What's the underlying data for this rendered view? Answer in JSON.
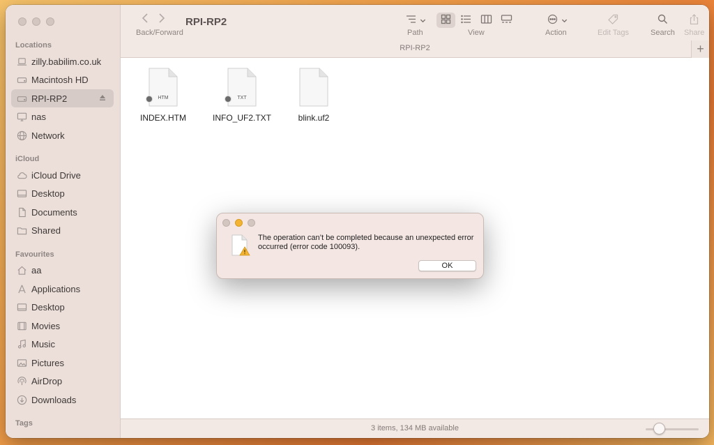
{
  "window": {
    "title": "RPI-RP2"
  },
  "sidebar": {
    "locations_title": "Locations",
    "locations": [
      {
        "label": "zilly.babilim.co.uk",
        "icon": "laptop-icon"
      },
      {
        "label": "Macintosh HD",
        "icon": "drive-icon"
      },
      {
        "label": "RPI-RP2",
        "icon": "drive-icon",
        "active": true
      },
      {
        "label": "nas",
        "icon": "display-icon"
      },
      {
        "label": "Network",
        "icon": "globe-icon"
      }
    ],
    "icloud_title": "iCloud",
    "icloud": [
      {
        "label": "iCloud Drive",
        "icon": "cloud-icon"
      },
      {
        "label": "Desktop",
        "icon": "desktop-icon"
      },
      {
        "label": "Documents",
        "icon": "document-icon"
      },
      {
        "label": "Shared",
        "icon": "shared-folder-icon"
      }
    ],
    "favourites_title": "Favourites",
    "favourites": [
      {
        "label": "aa",
        "icon": "home-icon"
      },
      {
        "label": "Applications",
        "icon": "applications-icon"
      },
      {
        "label": "Desktop",
        "icon": "desktop-icon"
      },
      {
        "label": "Movies",
        "icon": "film-icon"
      },
      {
        "label": "Music",
        "icon": "music-note-icon"
      },
      {
        "label": "Pictures",
        "icon": "photo-icon"
      },
      {
        "label": "AirDrop",
        "icon": "airdrop-icon"
      },
      {
        "label": "Downloads",
        "icon": "download-icon"
      }
    ],
    "tags_title": "Tags"
  },
  "toolbar": {
    "back_forward_label": "Back/Forward",
    "path_label": "Path",
    "view_label": "View",
    "action_label": "Action",
    "edit_tags_label": "Edit Tags",
    "search_label": "Search",
    "share_label": "Share",
    "path_bar": "RPI-RP2"
  },
  "files": [
    {
      "name": "INDEX.HTM",
      "ext": "HTM",
      "badge": true
    },
    {
      "name": "INFO_UF2.TXT",
      "ext": "TXT",
      "badge": true
    },
    {
      "name": "blink.uf2",
      "ext": "",
      "badge": false
    }
  ],
  "status": {
    "text": "3 items, 134 MB available",
    "icon_size_level": 0.25
  },
  "alert": {
    "message": "The operation can’t be completed because an unexpected error occurred (error code 100093).",
    "ok_label": "OK"
  },
  "colors": {
    "sidebar_bg": "#ecdfda",
    "toolbar_bg": "#f2e8e4",
    "alert_bg": "#f4e7e3",
    "warning": "#f3b433"
  }
}
